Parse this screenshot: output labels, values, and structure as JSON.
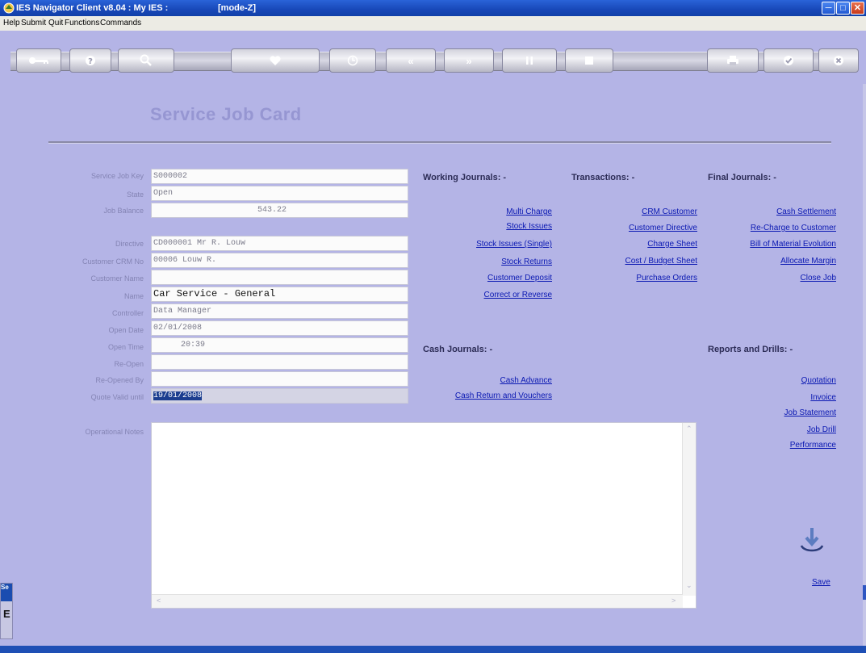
{
  "window": {
    "title": "IES Navigator Client v8.04 : My IES :",
    "mode": "[mode-Z]"
  },
  "menu": [
    "Help",
    "Submit",
    "Quit",
    "Functions",
    "Commands"
  ],
  "toolbar": {
    "icons": [
      "key-icon",
      "help-icon",
      "search-icon",
      "heart-icon",
      "clock-icon",
      "rewind-icon",
      "forward-icon",
      "pause-icon",
      "stop-icon",
      "print-icon",
      "check-icon",
      "cancel-icon"
    ]
  },
  "page": {
    "title": "Service Job Card"
  },
  "form": {
    "service_job_key": {
      "label": "Service Job Key",
      "value": "S000002"
    },
    "state": {
      "label": "State",
      "value": "Open"
    },
    "job_balance": {
      "label": "Job Balance",
      "value": "543.22"
    },
    "directive": {
      "label": "Directive",
      "value": "CD000001 Mr R. Louw"
    },
    "customer_crm_no": {
      "label": "Customer CRM No",
      "value": "00006 Louw R."
    },
    "customer_name": {
      "label": "Customer Name",
      "value": ""
    },
    "name": {
      "label": "Name",
      "value": "Car Service - General"
    },
    "controller": {
      "label": "Controller",
      "value": "Data Manager"
    },
    "open_date": {
      "label": "Open Date",
      "value": "02/01/2008"
    },
    "open_time": {
      "label": "Open Time",
      "value": "20:39"
    },
    "re_open": {
      "label": "Re-Open",
      "value": ""
    },
    "re_opened_by": {
      "label": "Re-Opened By",
      "value": ""
    },
    "quote_valid_until": {
      "label": "Quote Valid until",
      "value": "19/01/2008"
    },
    "operational_notes": {
      "label": "Operational Notes",
      "value": ""
    }
  },
  "working_journals": {
    "heading": "Working Journals: -",
    "links": [
      "Multi Charge",
      "Stock Issues",
      "Stock Issues (Single)",
      "Stock Returns",
      "Customer Deposit",
      "Correct or Reverse"
    ]
  },
  "transactions": {
    "heading": "Transactions: -",
    "links": [
      "CRM Customer",
      "Customer Directive",
      "Charge Sheet",
      "Cost / Budget Sheet",
      "Purchase Orders"
    ]
  },
  "final_journals": {
    "heading": "Final Journals: -",
    "links": [
      "Cash Settlement",
      "Re-Charge to Customer",
      "Bill of Material Evolution",
      "Allocate Margin",
      "Close Job"
    ]
  },
  "cash_journals": {
    "heading": "Cash Journals: -",
    "links": [
      "Cash Advance",
      "Cash Return and Vouchers"
    ]
  },
  "reports": {
    "heading": "Reports and Drills: -",
    "links": [
      "Quotation",
      "Invoice",
      "Job Statement",
      "Job Drill",
      "Performance"
    ]
  },
  "save": {
    "label": "Save"
  },
  "side_stub": {
    "top_label": "Se",
    "glyph": "E"
  }
}
